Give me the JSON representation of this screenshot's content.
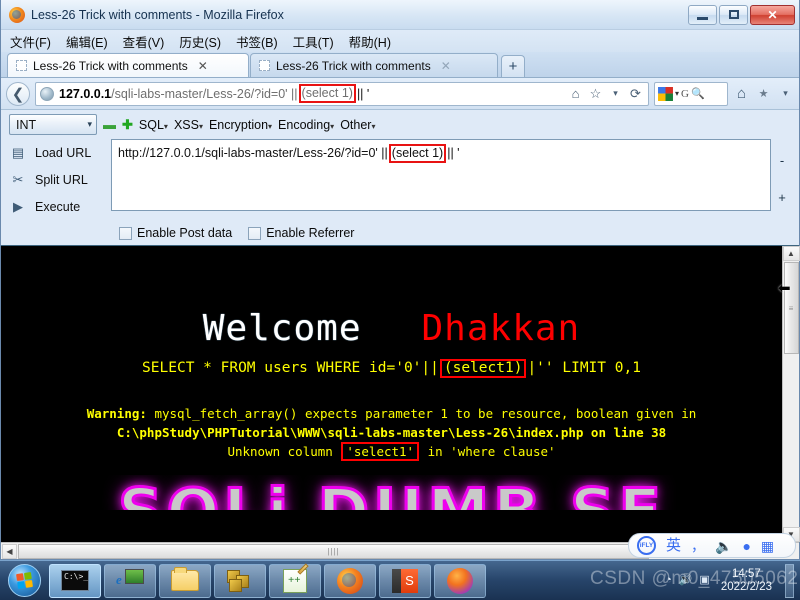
{
  "window": {
    "title": "Less-26 Trick with comments - Mozilla Firefox",
    "minimize_label": "Minimize",
    "maximize_label": "Maximize",
    "close_label": "✕"
  },
  "menubar": {
    "items": [
      {
        "label": "文件(F)"
      },
      {
        "label": "编辑(E)"
      },
      {
        "label": "查看(V)"
      },
      {
        "label": "历史(S)"
      },
      {
        "label": "书签(B)"
      },
      {
        "label": "工具(T)"
      },
      {
        "label": "帮助(H)"
      }
    ]
  },
  "tabs": {
    "items": [
      {
        "title": "Less-26 Trick with comments",
        "close": "✕",
        "active": true
      },
      {
        "title": "Less-26 Trick with comments",
        "close": "✕",
        "active": false
      }
    ],
    "new_tab_label": "+"
  },
  "navbar": {
    "back_glyph": "❮",
    "url": {
      "host": "127.0.0.1",
      "path": "/sqli-labs-master/Less-26/?id=0' ||",
      "highlight": "(select 1)",
      "tail": "|| '"
    },
    "icons": {
      "home_star_glyph": "⌂",
      "bookmark_glyph": "☆",
      "dropdown_glyph": "▾",
      "reload_glyph": "⟳",
      "google_dropdown_glyph": "▾",
      "google_label": "G",
      "search_glyph": "🔍",
      "home_glyph": "⌂",
      "extra_glyph": "▾"
    }
  },
  "hackbar": {
    "type_selector": {
      "value": "INT",
      "caret": "▾"
    },
    "minus_label": "▬",
    "plus_label": "✚",
    "menus": [
      {
        "label": "SQL",
        "caret": "▾"
      },
      {
        "label": "XSS",
        "caret": "▾"
      },
      {
        "label": "Encryption",
        "caret": "▾"
      },
      {
        "label": "Encoding",
        "caret": "▾"
      },
      {
        "label": "Other",
        "caret": "▾"
      }
    ],
    "actions": [
      {
        "label": "Load URL",
        "icon": "▤"
      },
      {
        "label": "Split URL",
        "icon": "✂"
      },
      {
        "label": "Execute",
        "icon": "▶"
      }
    ],
    "url_field": {
      "prefix": "http://127.0.0.1/sqli-labs-master/Less-26/?id=0' ||",
      "highlight": "(select 1)",
      "suffix": "|| '"
    },
    "stepper": {
      "minus": "-",
      "plus": "+"
    },
    "checkboxes": [
      {
        "label": "Enable Post data",
        "checked": false
      },
      {
        "label": "Enable Referrer",
        "checked": false
      }
    ]
  },
  "page": {
    "welcome": "Welcome",
    "dhakkan": "Dhakkan",
    "sql_query": {
      "prefix": "SELECT * FROM users WHERE id='0'||",
      "highlight": "(select1)",
      "suffix": "|'' LIMIT 0,1"
    },
    "warning": {
      "label": "Warning:",
      "line1": " mysql_fetch_array() expects parameter 1 to be resource, boolean given in",
      "line2": "C:\\phpStudy\\PHPTutorial\\WWW\\sqli-labs-master\\Less-26\\index.php on line 38",
      "line3_prefix": "Unknown column ",
      "line3_highlight": "'select1'",
      "line3_suffix": " in 'where clause'"
    },
    "banner": "SQLi DUMB SE"
  },
  "scrollbars": {
    "v_up": "▲",
    "v_down": "▼",
    "v_grip": "≡",
    "h_left": "◀",
    "h_grip": "||||",
    "drag_cursor": "⬅"
  },
  "ime": {
    "logo": "iFLY",
    "mode": "英",
    "punctuation": "，",
    "microphone": "🎤",
    "user": "👤",
    "apps": "⊞"
  },
  "taskbar": {
    "start_label": "Start",
    "items": [
      {
        "name": "command-prompt",
        "label": "C:\\>_",
        "selected": true
      },
      {
        "name": "internet-explorer",
        "label": "e",
        "selected": false
      },
      {
        "name": "file-explorer",
        "label": "Explorer",
        "selected": false
      },
      {
        "name": "database-tool",
        "label": "DB",
        "selected": false
      },
      {
        "name": "notepad-plus-plus",
        "label": "++",
        "selected": false
      },
      {
        "name": "firefox",
        "label": "Firefox",
        "selected": false
      },
      {
        "name": "sublime-text",
        "label": "S",
        "selected": false
      },
      {
        "name": "firefox-quantum",
        "label": "Firefox",
        "selected": false
      }
    ],
    "tray": {
      "network": "◔",
      "volume": "🔈",
      "action_center": "▣",
      "time": "14:57",
      "date": "2022/2/23"
    }
  },
  "watermark": "CSDN @m0_47505062"
}
